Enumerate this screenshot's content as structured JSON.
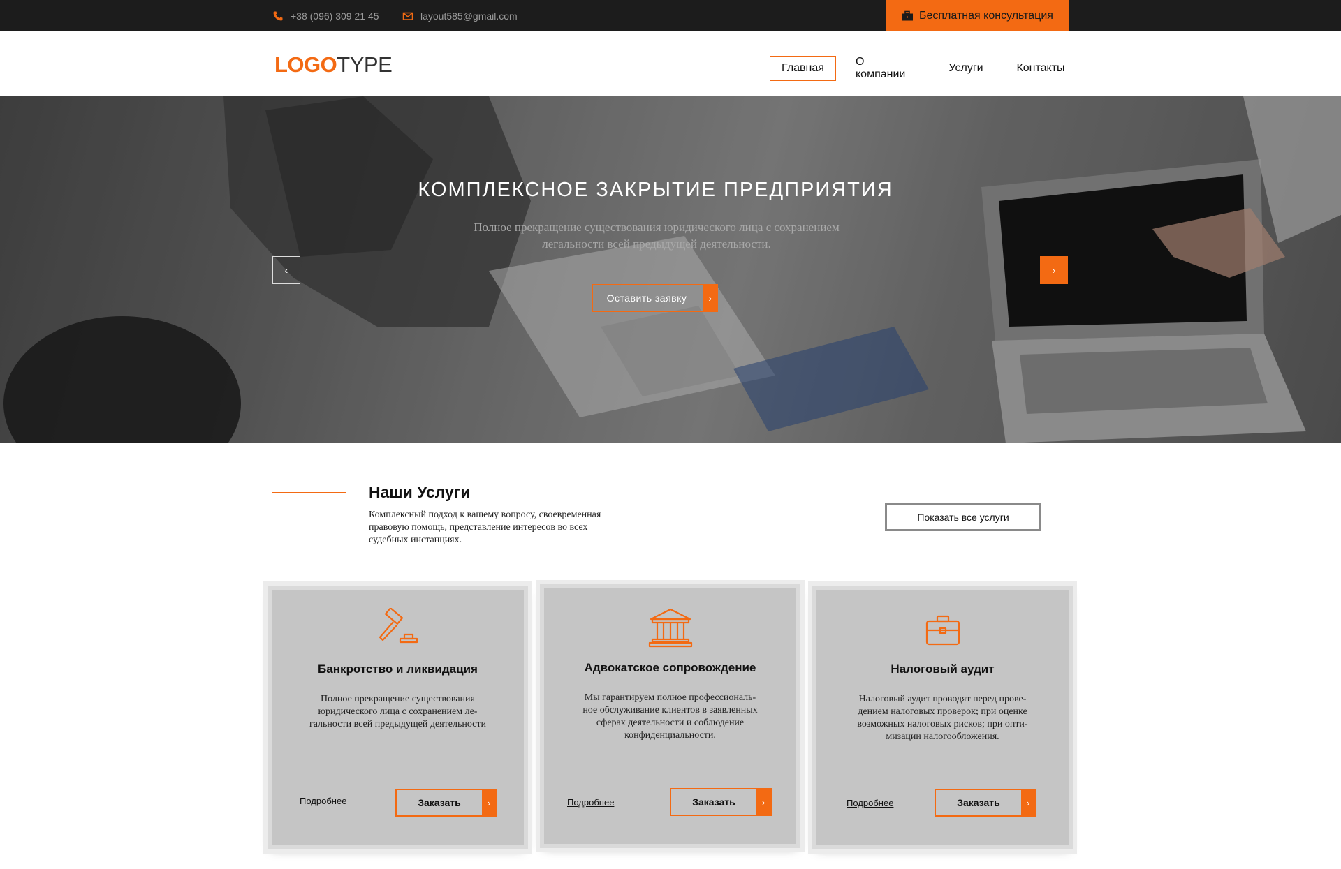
{
  "topbar": {
    "phone": "+38 (096) 309 21 45",
    "email": "layout585@gmail.com",
    "consult_label": "Бесплатная консультация",
    "phone_icon": "phone-icon",
    "email_icon": "envelope-icon",
    "consult_icon": "briefcase-icon"
  },
  "header": {
    "logo_part1": "LOGO",
    "logo_part2": "TYPE",
    "nav": [
      {
        "label": "Главная",
        "active": true
      },
      {
        "label": "О компании",
        "active": false
      },
      {
        "label": "Услуги",
        "active": false
      },
      {
        "label": "Контакты",
        "active": false
      }
    ]
  },
  "hero": {
    "title": "КОМПЛЕКСНОЕ ЗАКРЫТИЕ ПРЕДПРИЯТИЯ",
    "subtitle_line1": "Полное прекращение существования юридического лица с сохранением",
    "subtitle_line2": "легальности всей предыдущей деятельности.",
    "cta_label": "Оставить заявку",
    "prev_glyph": "‹",
    "next_glyph": "›",
    "arrow_glyph": "›"
  },
  "services": {
    "title": "Наши Услуги",
    "desc_line1": "Комплексный подход к вашему вопросу, своевременная",
    "desc_line2": "правовую помощь, представление интересов во всех",
    "desc_line3": "судебных инстанциях.",
    "show_all_label": "Показать все услуги",
    "cards": [
      {
        "icon": "gavel-icon",
        "title": "Банкротство и ликвидация",
        "lines": [
          "Полное прекращение существования",
          "юридического лица с сохранением ле-",
          "гальности всей предыдущей деятельности"
        ],
        "more_label": "Подробнее",
        "order_label": "Заказать"
      },
      {
        "icon": "courthouse-icon",
        "title": "Адвокатское сопровождение",
        "lines": [
          "Мы гарантируем полное профессиональ-",
          "ное обслуживание клиентов в заявленных",
          "сферах деятельности и соблюдение",
          "конфиденциальности."
        ],
        "more_label": "Подробнее",
        "order_label": "Заказать"
      },
      {
        "icon": "briefcase-icon",
        "title": "Налоговый аудит",
        "lines": [
          "Налоговый аудит проводят перед прове-",
          "дением налоговых проверок; при оценке",
          "возможных налоговых рисков; при опти-",
          "мизации налогообложения."
        ],
        "more_label": "Подробнее",
        "order_label": "Заказать"
      }
    ]
  },
  "colors": {
    "accent": "#f36a13",
    "topbar_bg": "#1c1c1c",
    "card_bg": "#c5c5c5"
  }
}
